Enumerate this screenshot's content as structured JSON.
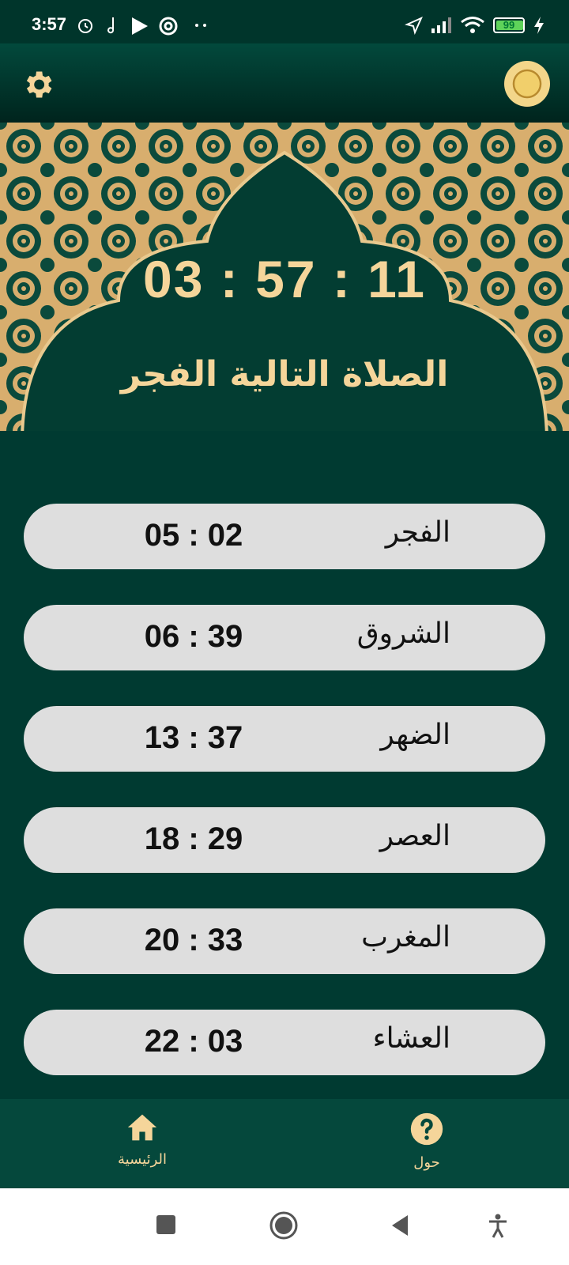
{
  "status_bar": {
    "time": "3:57",
    "battery": "99",
    "icons": [
      "alarm-icon",
      "music-icon",
      "play-store-icon",
      "at-icon",
      "more-dots-icon",
      "location-icon",
      "signal-icon",
      "wifi-icon",
      "battery-icon",
      "charging-icon"
    ]
  },
  "app_bar": {
    "settings_icon": "gear-icon",
    "logo_icon": "allah-calligraphy-logo"
  },
  "header": {
    "countdown": "03 : 57 : 11",
    "next_prayer": "الصلاة التالية الفجر"
  },
  "prayers": [
    {
      "name": "الفجر",
      "time": "05 : 02"
    },
    {
      "name": "الشروق",
      "time": "06 : 39"
    },
    {
      "name": "الضهر",
      "time": "13 : 37"
    },
    {
      "name": "العصر",
      "time": "18 : 29"
    },
    {
      "name": "المغرب",
      "time": "20 : 33"
    },
    {
      "name": "العشاء",
      "time": "22 : 03"
    }
  ],
  "bottom_nav": {
    "home_label": "الرئيسية",
    "about_label": "حول"
  },
  "colors": {
    "background": "#003a31",
    "accent_gold": "#f5d59a",
    "row_bg": "#dedede",
    "nav_bg": "#05483c"
  }
}
